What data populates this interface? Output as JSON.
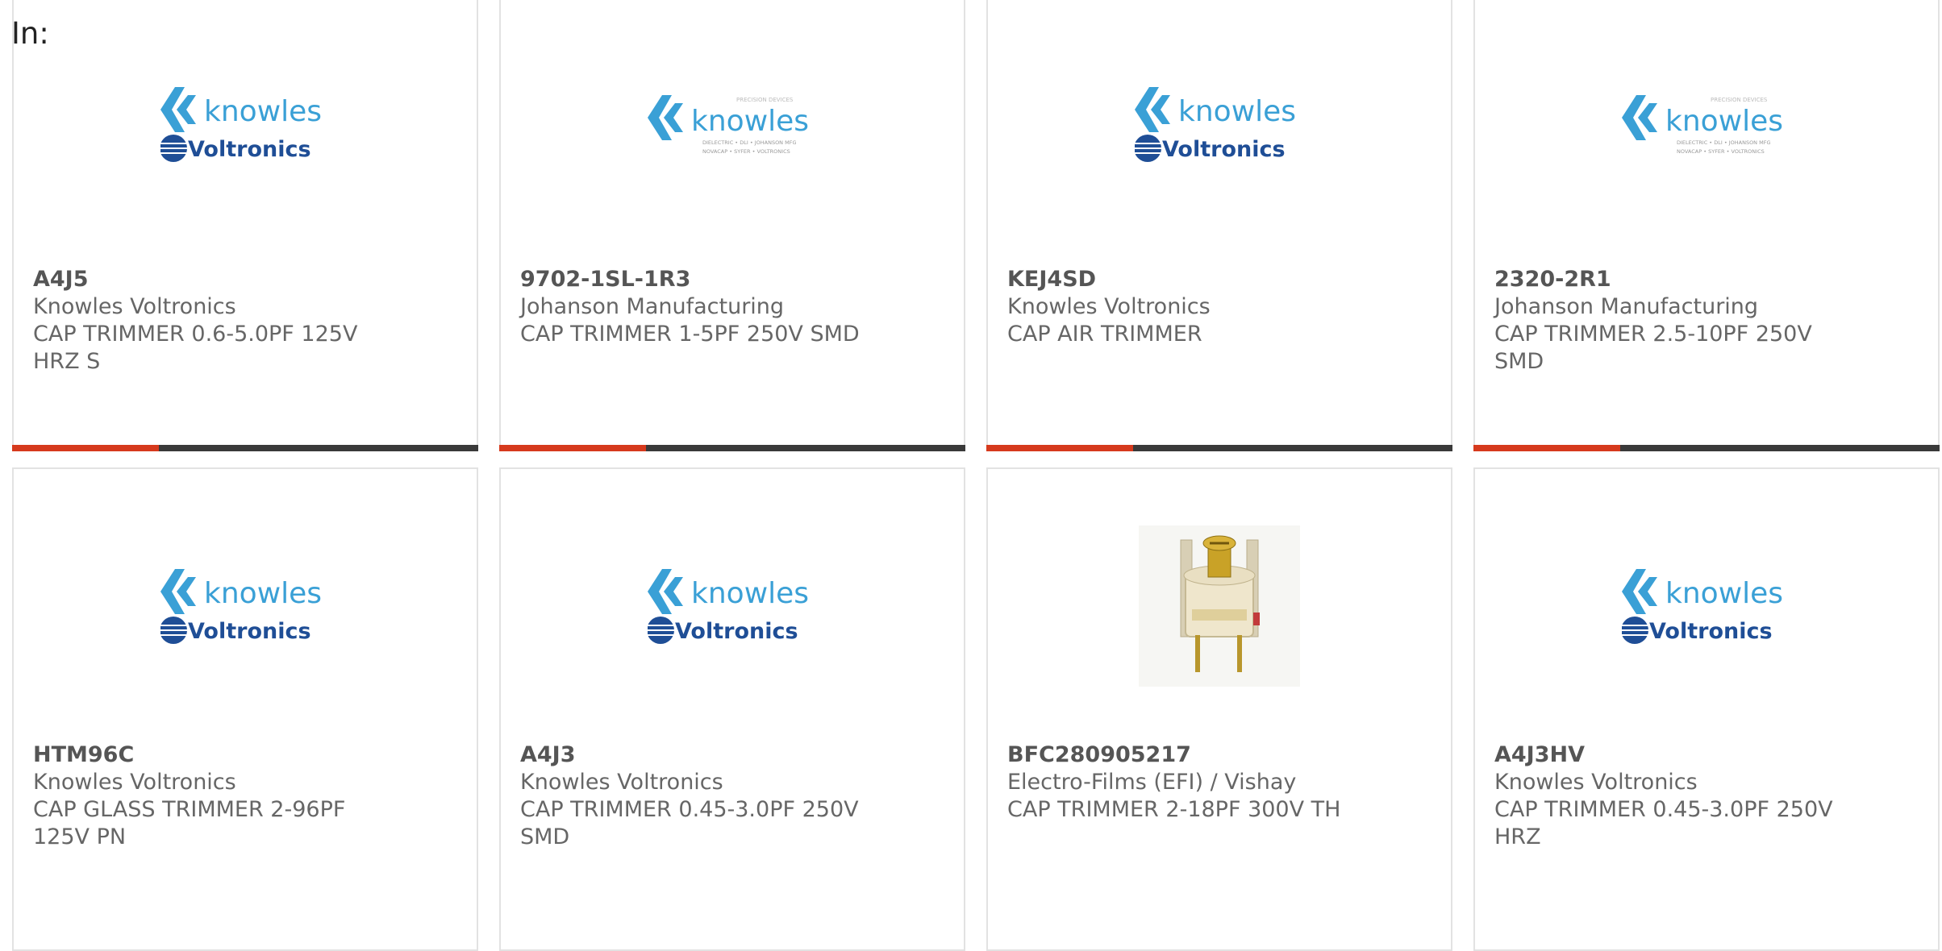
{
  "header": {
    "label": "In:"
  },
  "logo": {
    "brand": "knowles",
    "sub_brand": "Voltronics",
    "tagline": "PRECISION DEVICES",
    "brands_line1": "DIELECTRIC • DLI • JOHANSON MFG",
    "brands_line2": "NOVACAP • SYFER • VOLTRONICS"
  },
  "products": [
    {
      "part_number": "A4J5",
      "manufacturer": "Knowles Voltronics",
      "desc1": "CAP TRIMMER 0.6-5.0PF 125V",
      "desc2": "HRZ S",
      "image": "knowles-voltronics-logo"
    },
    {
      "part_number": "9702-1SL-1R3",
      "manufacturer": "Johanson Manufacturing",
      "desc1": "CAP TRIMMER 1-5PF 250V SMD",
      "desc2": "",
      "image": "knowles-precision-devices-logo"
    },
    {
      "part_number": "KEJ4SD",
      "manufacturer": "Knowles Voltronics",
      "desc1": "CAP AIR TRIMMER",
      "desc2": "",
      "image": "knowles-voltronics-logo"
    },
    {
      "part_number": "2320-2R1",
      "manufacturer": "Johanson Manufacturing",
      "desc1": "CAP TRIMMER 2.5-10PF 250V",
      "desc2": "SMD",
      "image": "knowles-precision-devices-logo"
    },
    {
      "part_number": "HTM96C",
      "manufacturer": "Knowles Voltronics",
      "desc1": "CAP GLASS TRIMMER 2-96PF",
      "desc2": "125V PN",
      "image": "knowles-voltronics-logo"
    },
    {
      "part_number": "A4J3",
      "manufacturer": "Knowles Voltronics",
      "desc1": "CAP TRIMMER 0.45-3.0PF 250V",
      "desc2": "SMD",
      "image": "knowles-voltronics-logo"
    },
    {
      "part_number": "BFC280905217",
      "manufacturer": "Electro-Films (EFI) / Vishay",
      "desc1": "CAP TRIMMER 2-18PF 300V TH",
      "desc2": "",
      "image": "trimmer-capacitor-photo"
    },
    {
      "part_number": "A4J3HV",
      "manufacturer": "Knowles Voltronics",
      "desc1": "CAP TRIMMER 0.45-3.0PF 250V",
      "desc2": "HRZ",
      "image": "knowles-voltronics-logo"
    }
  ],
  "colors": {
    "accent": "#d63a1d",
    "bar": "#3a3a3a",
    "logo_blue": "#3aa0d6",
    "voltronics_blue": "#1f4e96"
  }
}
